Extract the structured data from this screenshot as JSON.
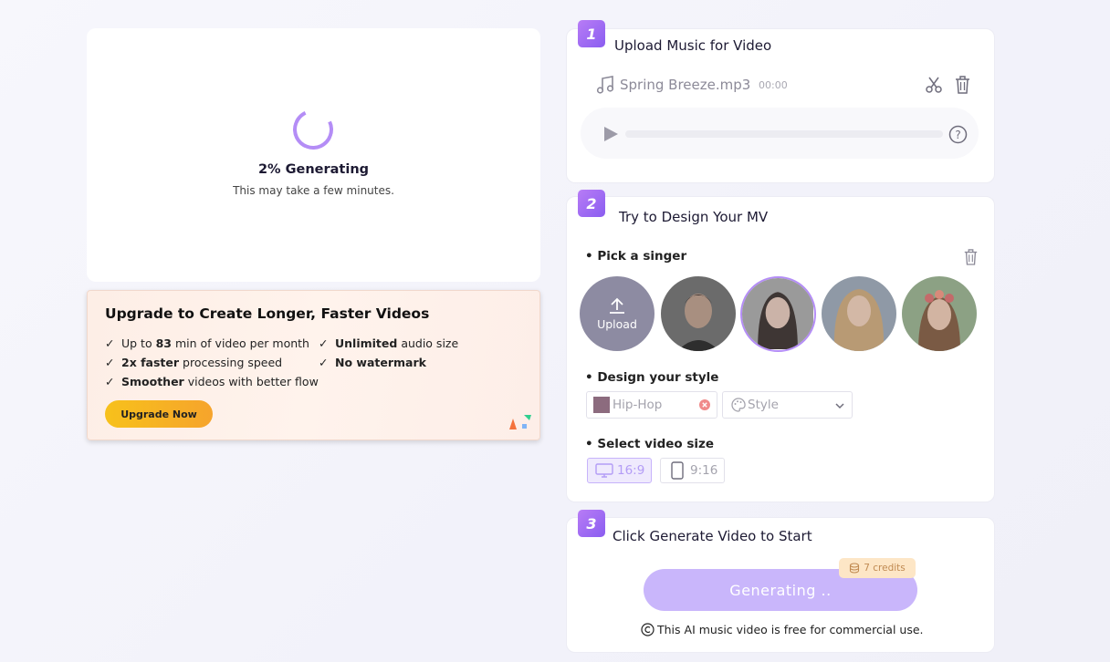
{
  "preview": {
    "status": "2% Generating",
    "subtitle": "This may take a few minutes."
  },
  "upgrade": {
    "title": "Upgrade to Create Longer, Faster Videos",
    "features": {
      "f1_pre": "Up to ",
      "f1_bold": "83",
      "f1_post": " min of video per month",
      "f2_bold": "2x faster",
      "f2_post": " processing speed",
      "f3_bold": "Smoother",
      "f3_post": " videos with better flow",
      "f4_bold": "Unlimited",
      "f4_post": " audio size",
      "f5_bold": "No watermark"
    },
    "button": "Upgrade Now"
  },
  "step1": {
    "number": "1",
    "title": "Upload Music for Video",
    "file_name": "Spring Breeze.mp3",
    "duration": "00:00"
  },
  "step2": {
    "number": "2",
    "title": "Try to Design Your MV",
    "singer_label": "Pick a singer",
    "upload_label": "Upload",
    "style_label": "Design your style",
    "genre": "Hip-Hop",
    "style_placeholder": "Style",
    "size_label": "Select video size",
    "size_options": [
      "16:9",
      "9:16"
    ],
    "selected_size": "16:9"
  },
  "step3": {
    "number": "3",
    "title": "Click Generate Video to Start",
    "button": "Generating ..",
    "credits": "7 credits",
    "license": "This AI music video is free for commercial use."
  },
  "colors": {
    "accent": "#8a5df0",
    "accent_light": "#c9b6fb",
    "upgrade_button": "#f7c11b"
  }
}
